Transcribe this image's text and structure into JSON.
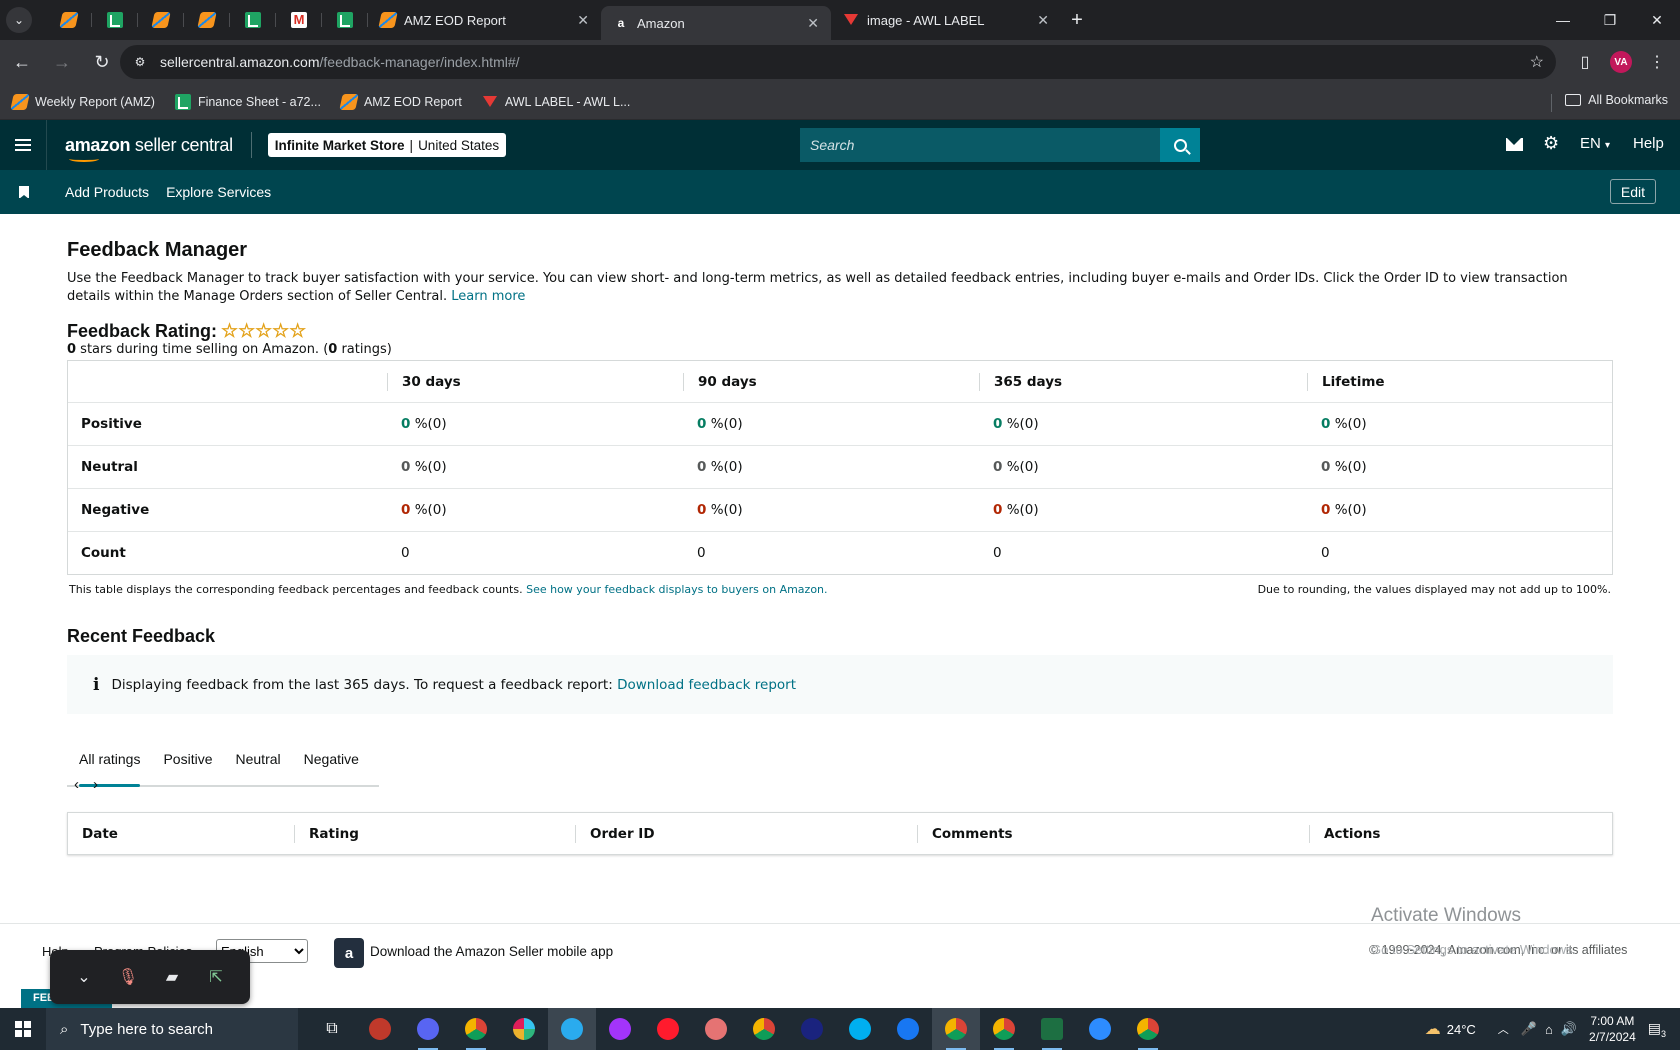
{
  "browser": {
    "tabs": [
      {
        "title": "AMZ EOD Report",
        "icon": "bolt-icon"
      },
      {
        "title": "Amazon",
        "icon": "amazon-icon",
        "active": true
      },
      {
        "title": "image - AWL LABEL",
        "icon": "awl-icon"
      }
    ],
    "url_host": "sellercentral.amazon.com",
    "url_path": "/feedback-manager/index.html#/",
    "profile_initials": "VA",
    "bookmarks": [
      {
        "label": "Weekly Report (AMZ)",
        "icon": "bolt-icon"
      },
      {
        "label": "Finance Sheet - a72...",
        "icon": "sheet-icon"
      },
      {
        "label": "AMZ EOD Report",
        "icon": "bolt-icon"
      },
      {
        "label": "AWL LABEL - AWL L...",
        "icon": "awl-icon"
      }
    ],
    "all_bookmarks": "All Bookmarks"
  },
  "header": {
    "logo_brand": "amazon",
    "logo_product": "seller central",
    "store_name": "Infinite Market Store",
    "marketplace": "United States",
    "search_placeholder": "Search",
    "language": "EN",
    "help": "Help",
    "subnav": [
      "Add Products",
      "Explore Services"
    ],
    "edit": "Edit"
  },
  "page": {
    "title": "Feedback Manager",
    "intro": "Use the Feedback Manager to track buyer satisfaction with your service. You can view short- and long-term metrics, as well as detailed feedback entries, including buyer e-mails and Order IDs. Click the Order ID to view transaction details within the Manage Orders section of Seller Central.",
    "learn_more": "Learn more",
    "rating_label": "Feedback Rating:",
    "stars": "☆☆☆☆☆",
    "rating_stars_count": "0",
    "rating_text_mid": " stars during time selling on Amazon. (",
    "rating_count": "0",
    "rating_text_end": " ratings)"
  },
  "metrics": {
    "columns": [
      "30 days",
      "90 days",
      "365 days",
      "Lifetime"
    ],
    "rows": [
      {
        "label": "Positive",
        "values": [
          {
            "num": "0",
            "rest": " %(0)"
          },
          {
            "num": "0",
            "rest": " %(0)"
          },
          {
            "num": "0",
            "rest": " %(0)"
          },
          {
            "num": "0",
            "rest": " %(0)"
          }
        ]
      },
      {
        "label": "Neutral",
        "values": [
          {
            "num": "0",
            "rest": " %(0)"
          },
          {
            "num": "0",
            "rest": " %(0)"
          },
          {
            "num": "0",
            "rest": " %(0)"
          },
          {
            "num": "0",
            "rest": " %(0)"
          }
        ]
      },
      {
        "label": "Negative",
        "values": [
          {
            "num": "0",
            "rest": " %(0)"
          },
          {
            "num": "0",
            "rest": " %(0)"
          },
          {
            "num": "0",
            "rest": " %(0)"
          },
          {
            "num": "0",
            "rest": " %(0)"
          }
        ]
      },
      {
        "label": "Count",
        "values": [
          "0",
          "0",
          "0",
          "0"
        ]
      }
    ],
    "note_left": "This table displays the corresponding feedback percentages and feedback counts.",
    "note_link": "See how your feedback displays to buyers on Amazon.",
    "note_right": "Due to rounding, the values displayed may not add up to 100%."
  },
  "recent": {
    "title": "Recent Feedback",
    "info_text": "Displaying feedback from the last 365 days. To request a feedback report:",
    "info_link": "Download feedback report",
    "tabs": [
      "All ratings",
      "Positive",
      "Neutral",
      "Negative"
    ],
    "pager_prev": "‹",
    "pager_next": "›",
    "table_columns": [
      "Date",
      "Rating",
      "Order ID",
      "Comments",
      "Actions"
    ]
  },
  "footer": {
    "help": "Help",
    "policies": "Program Policies",
    "language_selected": "English",
    "app_text": "Download the Amazon Seller mobile app",
    "copyright": "© 1999-2024, Amazon.com, Inc. or its affiliates",
    "feedback_tab": "FEEDBACK"
  },
  "overlay": {
    "activate_title": "Activate Windows",
    "activate_sub": "Go to Settings to activate Windows."
  },
  "taskbar": {
    "search_placeholder": "Type here to search",
    "weather": "24°C",
    "time": "7:00 AM",
    "date": "2/7/2024",
    "notification_count": "3"
  }
}
